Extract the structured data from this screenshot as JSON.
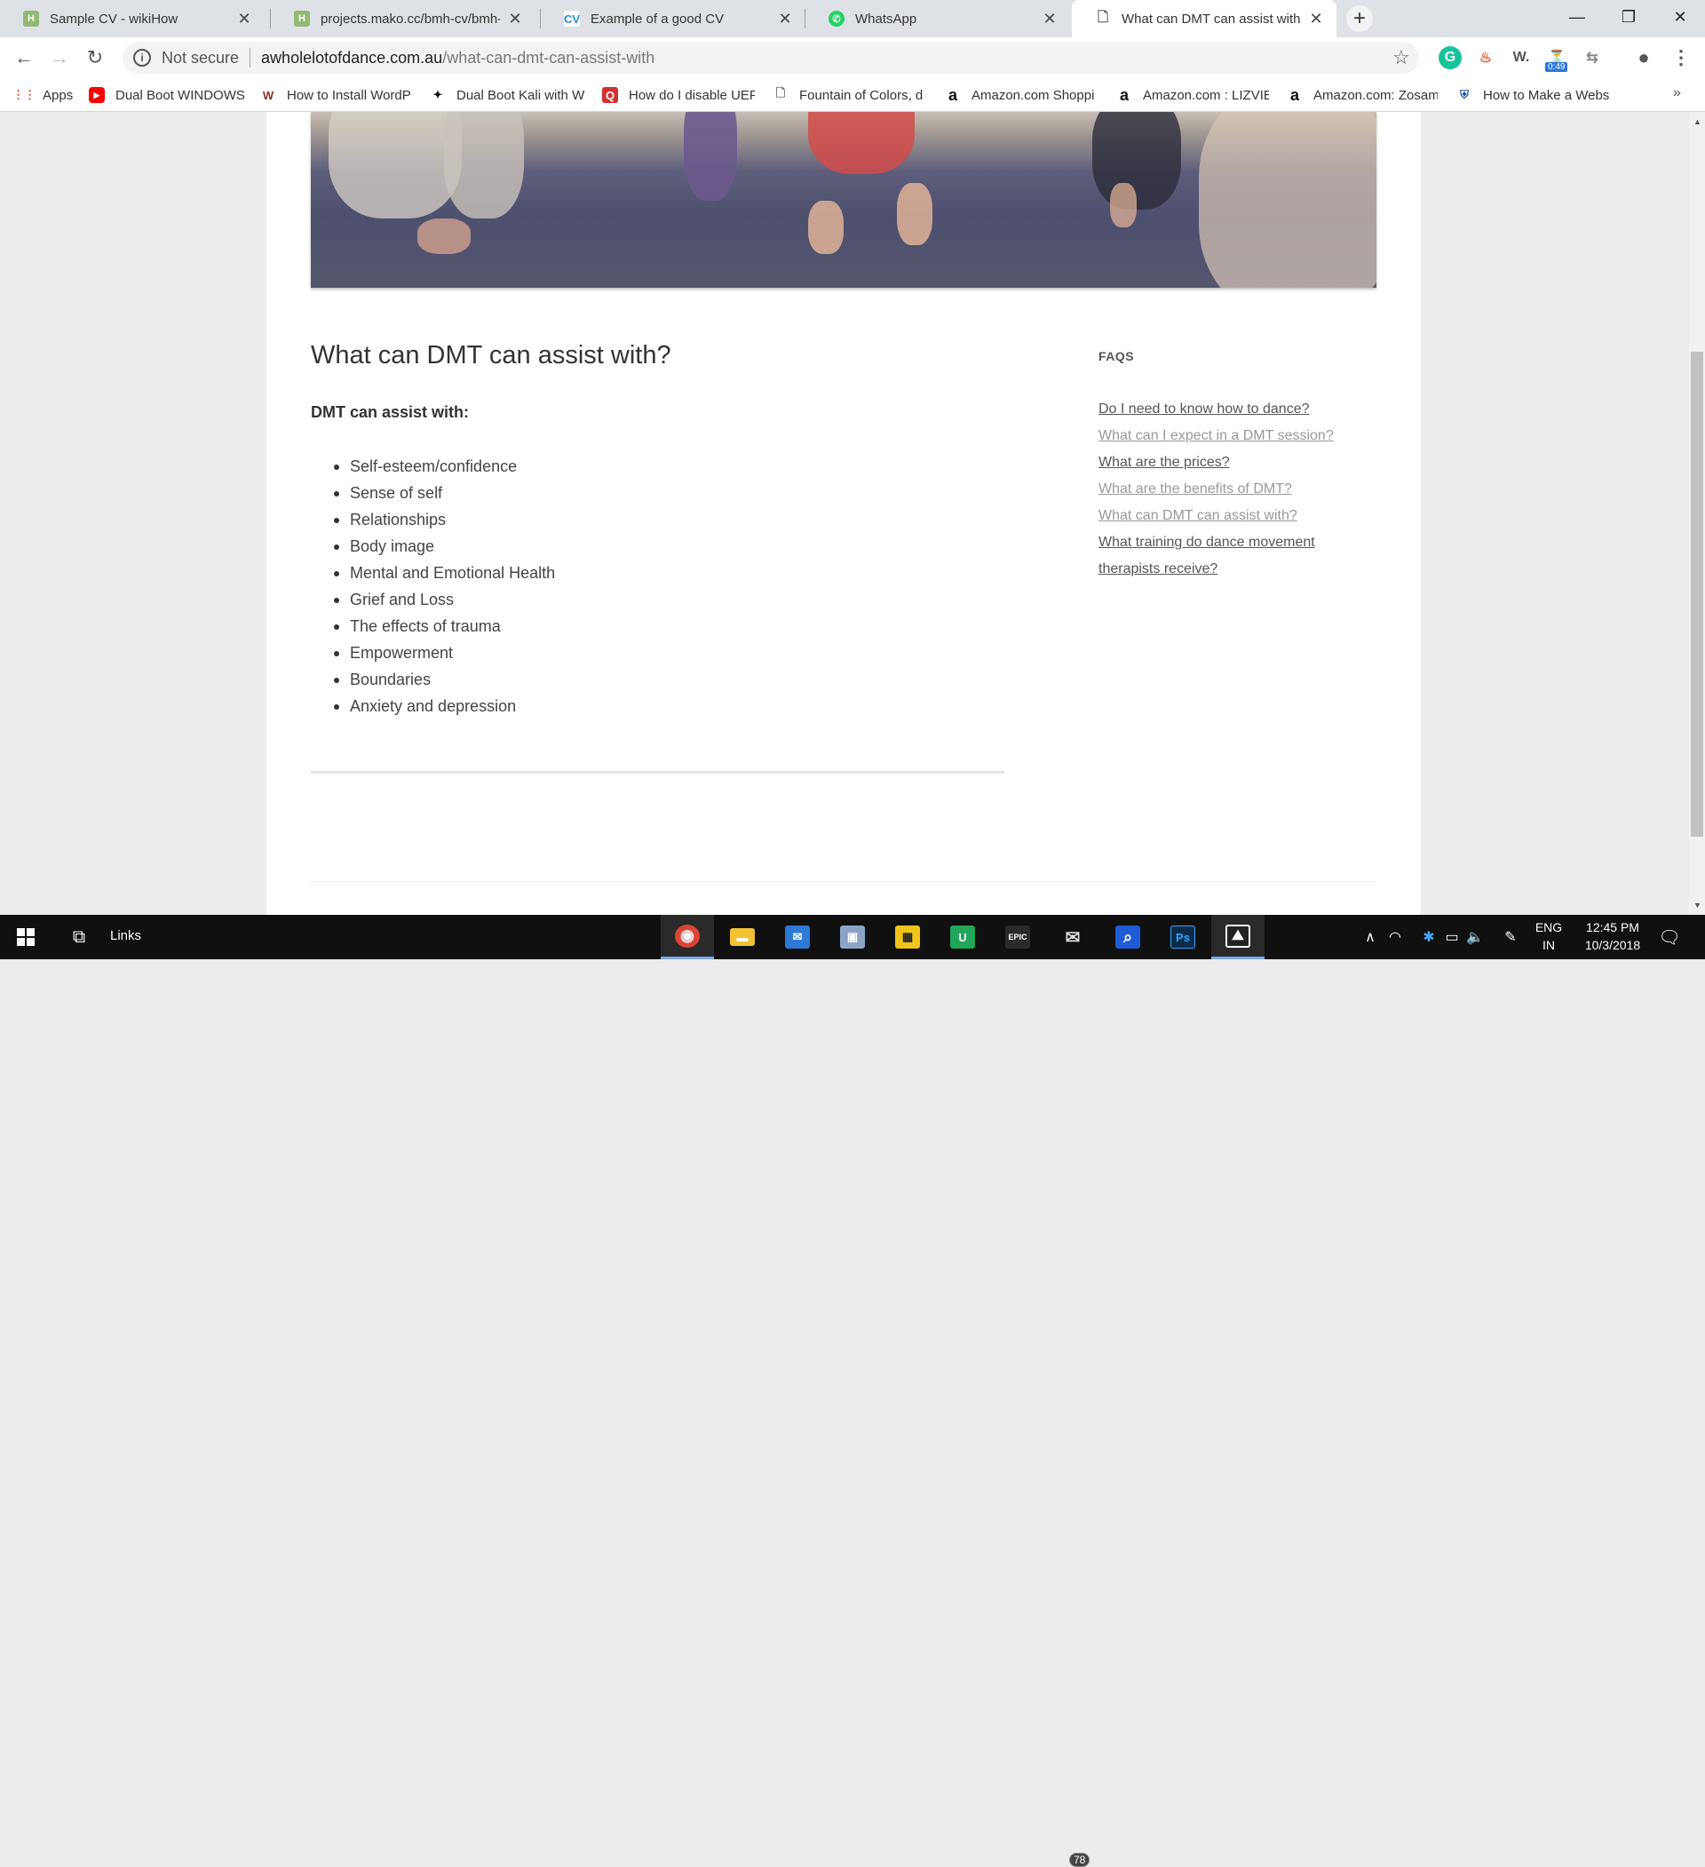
{
  "browser": {
    "tabs": [
      {
        "title": "Sample CV - wikiHow",
        "favicon": "wikihow-icon",
        "fav_color": "#93b874",
        "fav_text": "H"
      },
      {
        "title": "projects.mako.cc/bmh-cv/bmh-c",
        "favicon": "wikihow-icon",
        "fav_color": "#93b874",
        "fav_text": "H"
      },
      {
        "title": "Example of a good CV",
        "favicon": "cv-icon",
        "fav_color": "#2a8dd4",
        "fav_text": "CV"
      },
      {
        "title": "WhatsApp",
        "favicon": "whatsapp-icon",
        "fav_color": "#25d366",
        "fav_text": "✆"
      },
      {
        "title": "What can DMT can assist with? | ",
        "favicon": "page-icon",
        "fav_color": "#ffffff",
        "fav_text": "🗋"
      }
    ],
    "new_tab": "+",
    "window_controls": {
      "minimize": "—",
      "restore": "❐",
      "close": "✕"
    },
    "address": {
      "security_label": "Not secure",
      "host": "awholelotofdance.com.au",
      "path": "/what-can-dmt-can-assist-with"
    },
    "extensions": [
      {
        "name": "grammarly-icon",
        "glyph": "G",
        "color": "#15c39a"
      },
      {
        "name": "fire-extension-icon",
        "glyph": "♨",
        "color": "#e8542c"
      },
      {
        "name": "wordtune-icon",
        "glyph": "W.",
        "color": "#555555"
      },
      {
        "name": "timer-extension-icon",
        "glyph": "⏳",
        "color": "#333333"
      },
      {
        "name": "translate-extension-icon",
        "glyph": "⇆",
        "color": "#888888"
      },
      {
        "name": "account-icon",
        "glyph": "●",
        "color": "#555555"
      },
      {
        "name": "menu-icon",
        "glyph": "⋮",
        "color": "#555555"
      }
    ],
    "extension_badge": "0:49",
    "bookmarks": [
      {
        "label": "Apps",
        "icon": "apps-grid-icon",
        "glyph": "⋮⋮",
        "color": "#e94235"
      },
      {
        "label": "Dual Boot WINDOWS",
        "icon": "youtube-icon",
        "glyph": "▶",
        "color": "#ff0000"
      },
      {
        "label": "How to Install WordP",
        "icon": "wikihow-icon",
        "glyph": "W",
        "color": "#8b2f1f"
      },
      {
        "label": "Dual Boot Kali with W",
        "icon": "kali-icon",
        "glyph": "✦",
        "color": "#111111"
      },
      {
        "label": "How do I disable UEF",
        "icon": "answers-icon",
        "glyph": "Q",
        "color": "#d32f2f"
      },
      {
        "label": "Fountain of Colors, d",
        "icon": "page-icon",
        "glyph": "🗋",
        "color": "#666666"
      },
      {
        "label": "Amazon.com Shoppi",
        "icon": "amazon-icon",
        "glyph": "a",
        "color": "#111111"
      },
      {
        "label": "Amazon.com : LIZVIE",
        "icon": "amazon-icon",
        "glyph": "a",
        "color": "#111111"
      },
      {
        "label": "Amazon.com: Zosam",
        "icon": "amazon-icon",
        "glyph": "a",
        "color": "#111111"
      },
      {
        "label": "How to Make a Webs",
        "icon": "shield-icon",
        "glyph": "⛨",
        "color": "#1e4fa0"
      }
    ],
    "bookmarks_more": "»"
  },
  "article": {
    "title": "What can DMT can assist with?",
    "intro": "DMT can assist with:",
    "items": [
      "Self-esteem/confidence",
      "Sense of self",
      "Relationships",
      "Body image",
      "Mental and Emotional Health",
      "Grief and Loss",
      "The effects of trauma",
      "Empowerment",
      "Boundaries",
      "Anxiety and depression"
    ]
  },
  "sidebar": {
    "heading": "FAQS",
    "links": [
      {
        "label": "Do I need to know how to dance?",
        "visited": false
      },
      {
        "label": "What can I expect in a DMT session?",
        "visited": true
      },
      {
        "label": "What are the prices?",
        "visited": false
      },
      {
        "label": "What are the benefits of DMT?",
        "visited": true
      },
      {
        "label": "What can DMT can assist with?",
        "visited": true
      },
      {
        "label": "What training do dance movement therapists receive?",
        "visited": false
      }
    ]
  },
  "taskbar": {
    "links_label": "Links",
    "apps": [
      {
        "name": "chrome-icon",
        "glyph": "◉",
        "color": "#db4437",
        "active": true
      },
      {
        "name": "file-explorer-icon",
        "glyph": "▬",
        "color": "#f3c233",
        "active": false
      },
      {
        "name": "outlook-icon",
        "glyph": "✉",
        "color": "#2d7ad6",
        "active": false
      },
      {
        "name": "photos-icon",
        "glyph": "▣",
        "color": "#8aa4c8",
        "active": false
      },
      {
        "name": "norton-icon",
        "glyph": "▦",
        "color": "#f0c419",
        "active": false
      },
      {
        "name": "upwork-icon",
        "glyph": "U",
        "color": "#22a65a",
        "active": false
      },
      {
        "name": "epic-games-icon",
        "glyph": "EPIC",
        "color": "#2b2b2b",
        "active": false
      },
      {
        "name": "mail-icon",
        "glyph": "✉",
        "color": "#dddddd",
        "active": false
      },
      {
        "name": "search-app-icon",
        "glyph": "⌕",
        "color": "#1e5bd6",
        "active": false
      },
      {
        "name": "photoshop-icon",
        "glyph": "Ps",
        "color": "#0d2a4a",
        "active": false
      },
      {
        "name": "image-viewer-icon",
        "glyph": "⛰",
        "color": "#222222",
        "active": true
      }
    ],
    "mail_badge": "78",
    "language": {
      "line1": "ENG",
      "line2": "IN"
    },
    "clock": {
      "time": "12:45 PM",
      "date": "10/3/2018"
    }
  }
}
